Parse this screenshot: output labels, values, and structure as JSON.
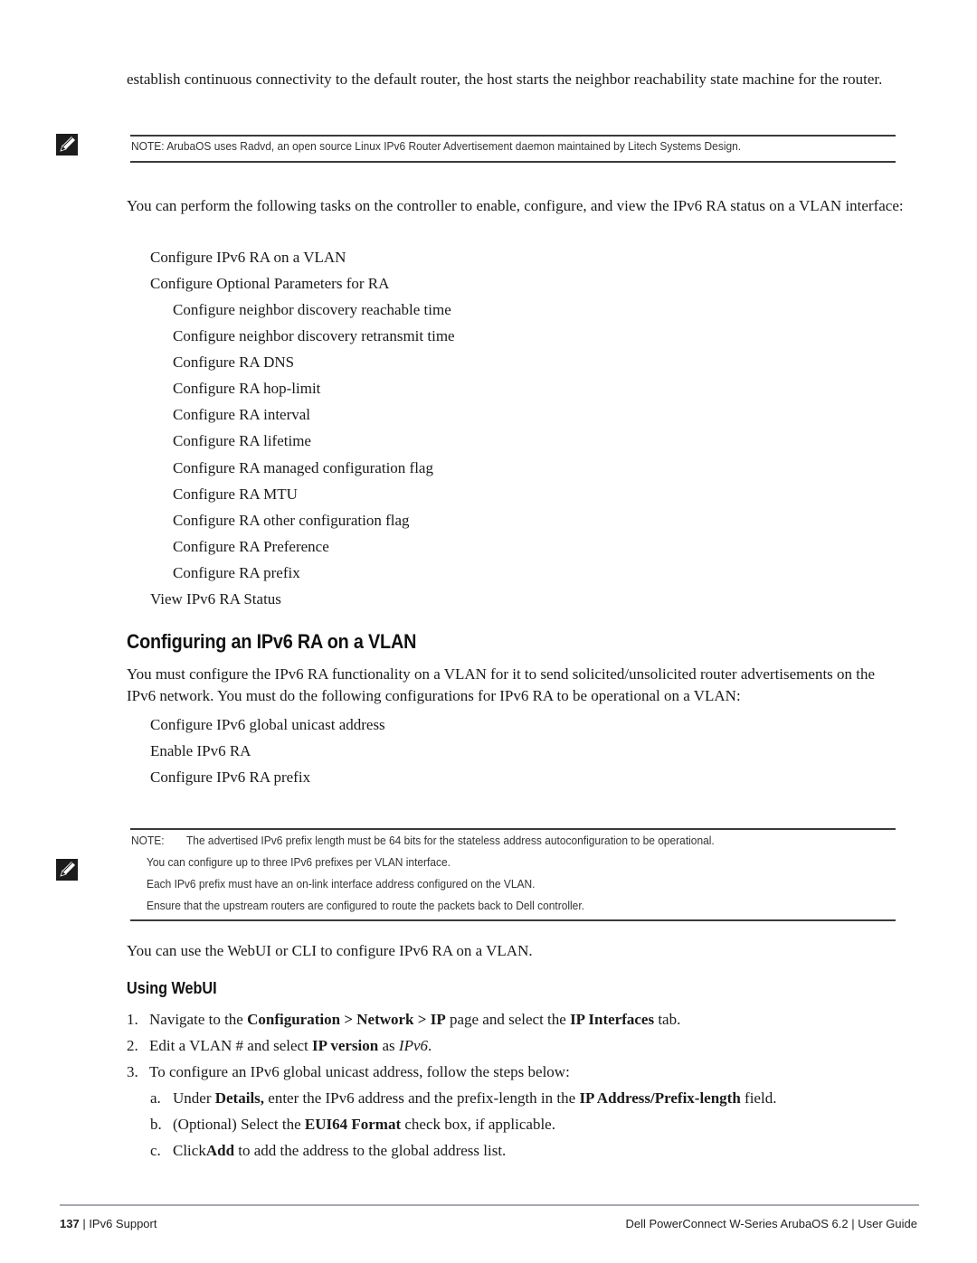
{
  "intro": {
    "continuation": "establish continuous connectivity to the default router, the host starts the neighbor reachability state machine for the router."
  },
  "note1": {
    "icon": "pencil-note-icon",
    "text": "NOTE: ArubaOS uses Radvd, an open source Linux IPv6 Router Advertisement daemon maintained by Litech Systems Design."
  },
  "tasks": {
    "lead": "You can perform the following tasks on the controller to enable, configure, and view the IPv6 RA status on a VLAN interface:",
    "items": [
      {
        "label": "Configure IPv6 RA on a VLAN",
        "level": 1
      },
      {
        "label": "Configure Optional Parameters for RA",
        "level": 1
      },
      {
        "label": "Configure neighbor discovery reachable time",
        "level": 2
      },
      {
        "label": "Configure neighbor discovery retransmit time",
        "level": 2
      },
      {
        "label": "Configure RA DNS",
        "level": 2
      },
      {
        "label": "Configure RA hop-limit",
        "level": 2
      },
      {
        "label": "Configure RA interval",
        "level": 2
      },
      {
        "label": "Configure RA lifetime",
        "level": 2
      },
      {
        "label": "Configure RA managed configuration flag",
        "level": 2
      },
      {
        "label": "Configure RA MTU",
        "level": 2
      },
      {
        "label": "Configure RA other configuration flag",
        "level": 2
      },
      {
        "label": "Configure RA Preference",
        "level": 2
      },
      {
        "label": "Configure RA prefix",
        "level": 2
      },
      {
        "label": "View IPv6 RA Status",
        "level": 1
      }
    ]
  },
  "section": {
    "title": "Configuring an IPv6 RA on a VLAN",
    "paragraph": "You must configure the IPv6 RA functionality on a VLAN for it to send solicited/unsolicited router advertisements on the IPv6 network. You must do the following configurations for IPv6 RA to be operational on a VLAN:",
    "items": [
      "Configure IPv6 global unicast address",
      "Enable IPv6 RA",
      "Configure IPv6 RA prefix"
    ]
  },
  "note2": {
    "icon": "pencil-note-icon",
    "label": "NOTE:",
    "lines": [
      "The advertised IPv6 prefix length must be 64 bits for the stateless address autoconfiguration to be operational.",
      "You can configure up to three IPv6 prefixes per VLAN interface.",
      "Each IPv6 prefix must have an on-link interface address configured on the VLAN.",
      "Ensure that the upstream routers are configured to route the packets back to Dell  controller."
    ]
  },
  "webui_cli": "You can use the WebUI or CLI to configure IPv6 RA on a VLAN.",
  "using_webui": {
    "title": "Using WebUI",
    "steps": [
      {
        "num": "1.",
        "pre": "Navigate to the ",
        "b1": "Configuration > Network > IP",
        "mid": " page and select the ",
        "b2": "IP Interfaces",
        "post": " tab."
      },
      {
        "num": "2.",
        "pre": "Edit a VLAN # and select ",
        "b1": "IP version",
        "mid": " as ",
        "i1": "IPv6",
        "post": "."
      },
      {
        "num": "3.",
        "text": "To configure an IPv6 global unicast address, follow the steps below:"
      }
    ],
    "substeps": [
      {
        "letter": "a.",
        "pre": "Under ",
        "b1": "Details,",
        "mid": " enter the IPv6 address and the prefix-length in the ",
        "b2": "IP Address/Prefix-length",
        "post": " field."
      },
      {
        "letter": "b.",
        "pre": "(Optional) Select the ",
        "b1": "EUI64 Format",
        "post": " check box, if applicable."
      },
      {
        "letter": "c.",
        "pre": "Click",
        "b1": "Add",
        "post": " to add the address to the global address list."
      }
    ]
  },
  "footer": {
    "page_number": "137",
    "chapter": "IPv6 Support",
    "doc_title": "Dell PowerConnect W-Series ArubaOS 6.2",
    "doc_type": "User Guide"
  }
}
